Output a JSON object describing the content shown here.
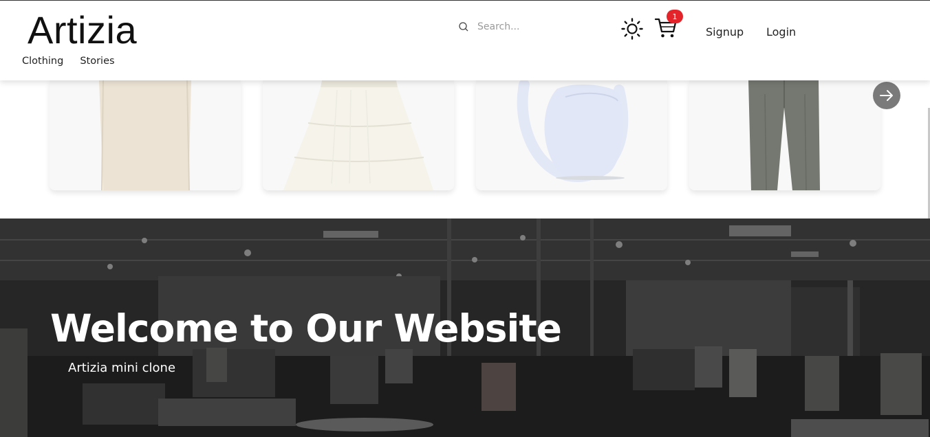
{
  "header": {
    "logo": "Artizia",
    "nav": [
      "Clothing",
      "Stories"
    ],
    "search_placeholder": "Search...",
    "cart_count": "1",
    "signup_label": "Signup",
    "login_label": "Login"
  },
  "carousel": {
    "products": [
      {
        "name": "beige-pants",
        "color": "#ece3d4"
      },
      {
        "name": "white-dress",
        "color": "#f4f2e8"
      },
      {
        "name": "blue-shoulder-bag",
        "color": "#e3e8f6"
      },
      {
        "name": "grey-trousers",
        "color": "#747870"
      }
    ]
  },
  "hero": {
    "title": "Welcome to Our Website",
    "subtitle": "Artizia mini clone"
  },
  "colors": {
    "badge": "#e3242b",
    "arrow_button": "#7a7a7a",
    "hero_overlay": "#2a2a2a"
  }
}
